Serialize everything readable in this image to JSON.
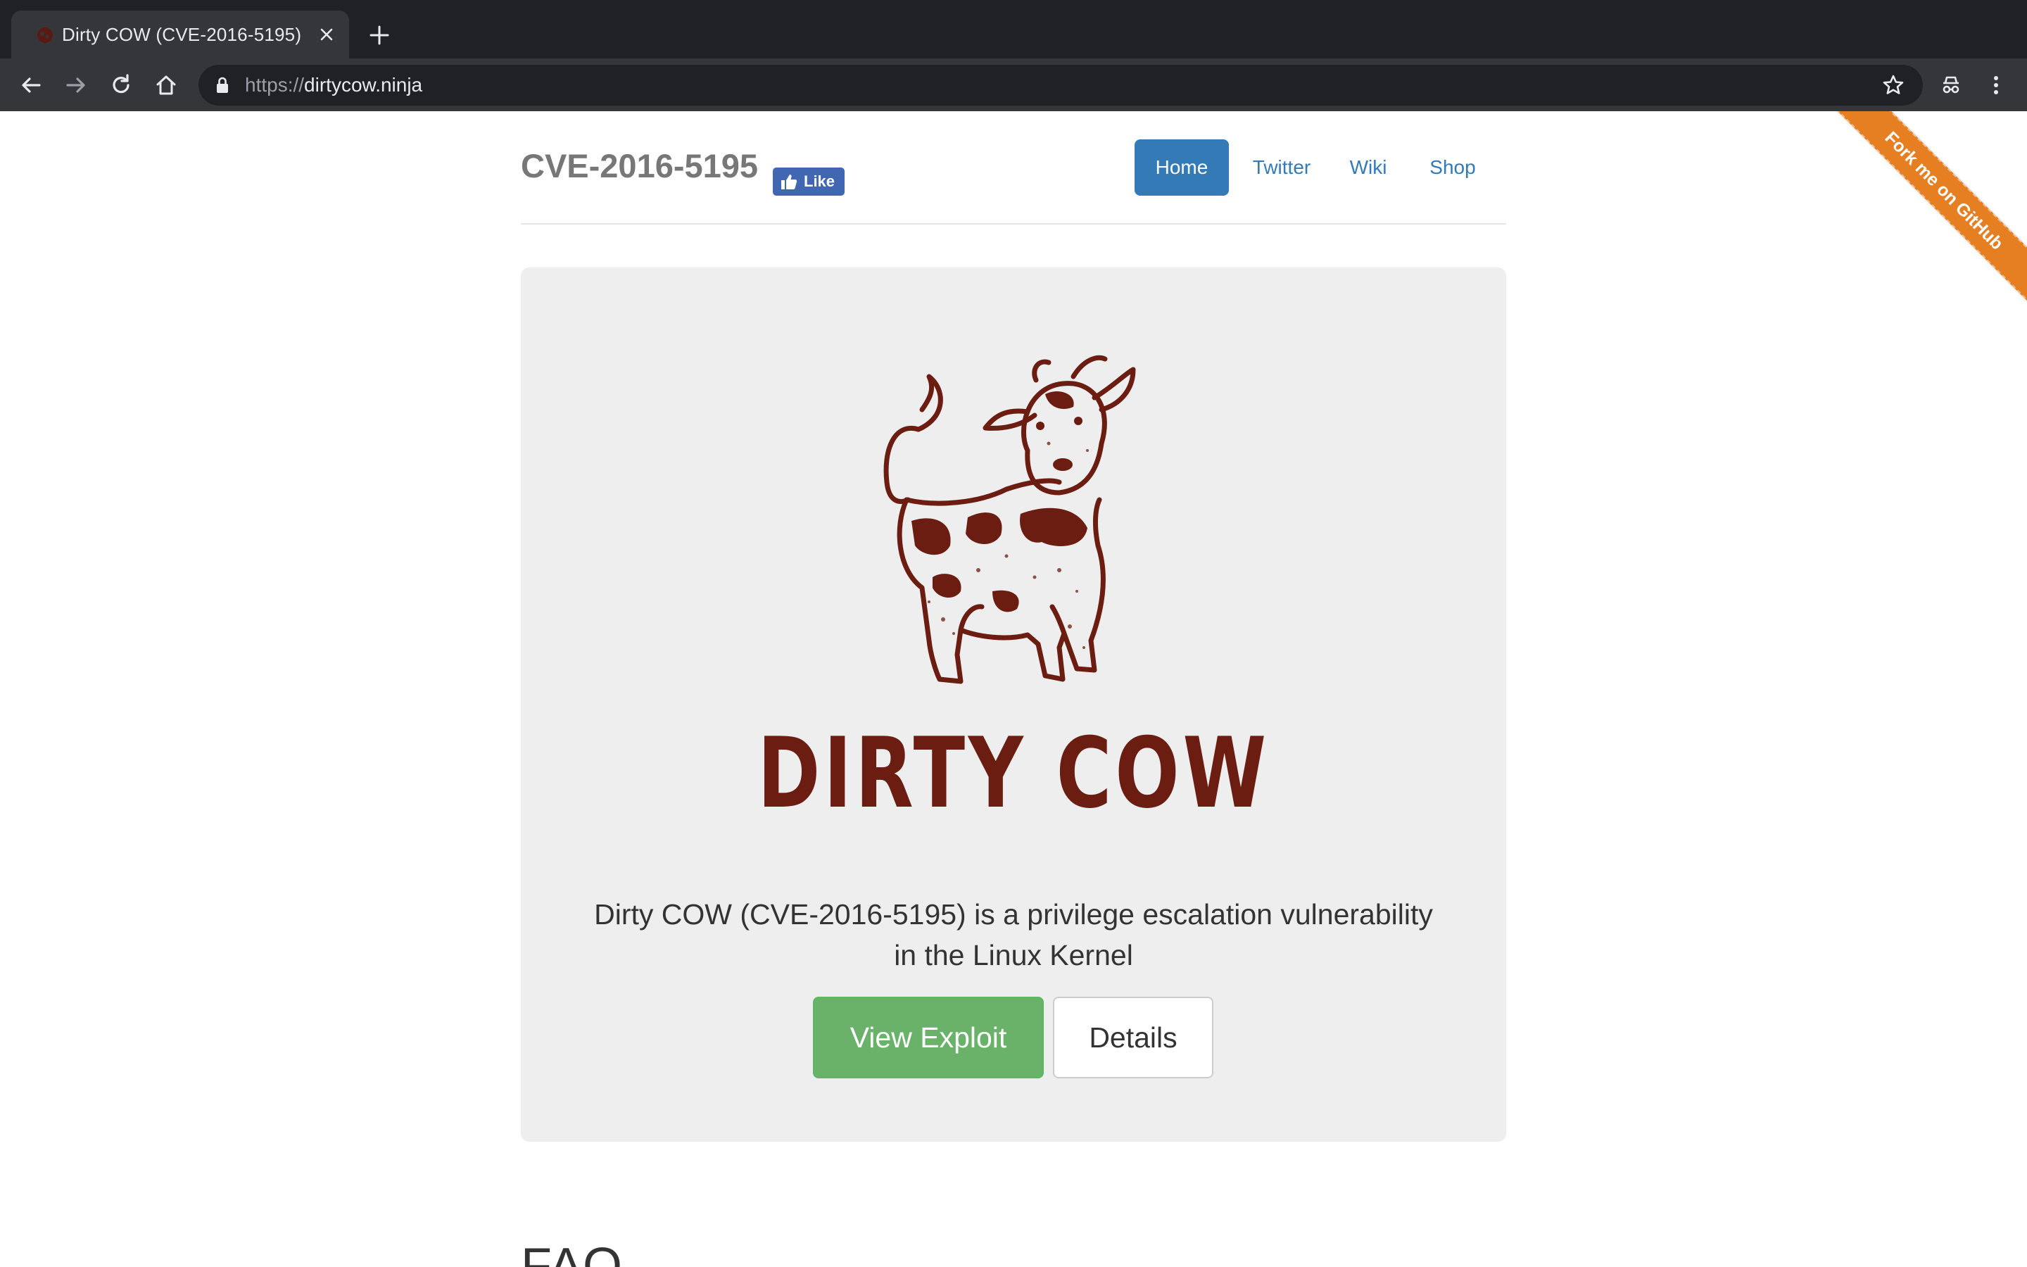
{
  "browser": {
    "tab_title": "Dirty COW (CVE-2016-5195)",
    "url_scheme": "https://",
    "url_host": "dirtycow.ninja"
  },
  "header": {
    "brand": "CVE-2016-5195",
    "fb_like_label": "Like",
    "nav": [
      {
        "label": "Home",
        "active": true
      },
      {
        "label": "Twitter",
        "active": false
      },
      {
        "label": "Wiki",
        "active": false
      },
      {
        "label": "Shop",
        "active": false
      }
    ]
  },
  "hero": {
    "wordmark": "DIRTY COW",
    "lead_line1": "Dirty COW (CVE-2016-5195) is a privilege escalation vulnerability",
    "lead_line2": "in the Linux Kernel",
    "primary_button": "View Exploit",
    "secondary_button": "Details"
  },
  "ribbon": {
    "label": "Fork me on GitHub"
  },
  "faq": {
    "heading": "FAQ"
  },
  "colors": {
    "brand_blue": "#337ab7",
    "success_green": "#6ab26a",
    "cow_brown": "#6b1d12",
    "ribbon_orange": "#e67e22"
  }
}
